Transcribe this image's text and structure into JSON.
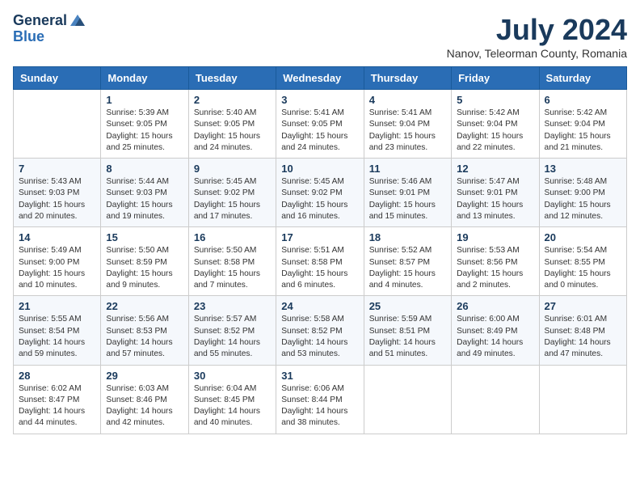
{
  "logo": {
    "line1": "General",
    "line2": "Blue"
  },
  "title": "July 2024",
  "subtitle": "Nanov, Teleorman County, Romania",
  "days_of_week": [
    "Sunday",
    "Monday",
    "Tuesday",
    "Wednesday",
    "Thursday",
    "Friday",
    "Saturday"
  ],
  "weeks": [
    [
      {
        "day": "",
        "info": ""
      },
      {
        "day": "1",
        "info": "Sunrise: 5:39 AM\nSunset: 9:05 PM\nDaylight: 15 hours\nand 25 minutes."
      },
      {
        "day": "2",
        "info": "Sunrise: 5:40 AM\nSunset: 9:05 PM\nDaylight: 15 hours\nand 24 minutes."
      },
      {
        "day": "3",
        "info": "Sunrise: 5:41 AM\nSunset: 9:05 PM\nDaylight: 15 hours\nand 24 minutes."
      },
      {
        "day": "4",
        "info": "Sunrise: 5:41 AM\nSunset: 9:04 PM\nDaylight: 15 hours\nand 23 minutes."
      },
      {
        "day": "5",
        "info": "Sunrise: 5:42 AM\nSunset: 9:04 PM\nDaylight: 15 hours\nand 22 minutes."
      },
      {
        "day": "6",
        "info": "Sunrise: 5:42 AM\nSunset: 9:04 PM\nDaylight: 15 hours\nand 21 minutes."
      }
    ],
    [
      {
        "day": "7",
        "info": "Sunrise: 5:43 AM\nSunset: 9:03 PM\nDaylight: 15 hours\nand 20 minutes."
      },
      {
        "day": "8",
        "info": "Sunrise: 5:44 AM\nSunset: 9:03 PM\nDaylight: 15 hours\nand 19 minutes."
      },
      {
        "day": "9",
        "info": "Sunrise: 5:45 AM\nSunset: 9:02 PM\nDaylight: 15 hours\nand 17 minutes."
      },
      {
        "day": "10",
        "info": "Sunrise: 5:45 AM\nSunset: 9:02 PM\nDaylight: 15 hours\nand 16 minutes."
      },
      {
        "day": "11",
        "info": "Sunrise: 5:46 AM\nSunset: 9:01 PM\nDaylight: 15 hours\nand 15 minutes."
      },
      {
        "day": "12",
        "info": "Sunrise: 5:47 AM\nSunset: 9:01 PM\nDaylight: 15 hours\nand 13 minutes."
      },
      {
        "day": "13",
        "info": "Sunrise: 5:48 AM\nSunset: 9:00 PM\nDaylight: 15 hours\nand 12 minutes."
      }
    ],
    [
      {
        "day": "14",
        "info": "Sunrise: 5:49 AM\nSunset: 9:00 PM\nDaylight: 15 hours\nand 10 minutes."
      },
      {
        "day": "15",
        "info": "Sunrise: 5:50 AM\nSunset: 8:59 PM\nDaylight: 15 hours\nand 9 minutes."
      },
      {
        "day": "16",
        "info": "Sunrise: 5:50 AM\nSunset: 8:58 PM\nDaylight: 15 hours\nand 7 minutes."
      },
      {
        "day": "17",
        "info": "Sunrise: 5:51 AM\nSunset: 8:58 PM\nDaylight: 15 hours\nand 6 minutes."
      },
      {
        "day": "18",
        "info": "Sunrise: 5:52 AM\nSunset: 8:57 PM\nDaylight: 15 hours\nand 4 minutes."
      },
      {
        "day": "19",
        "info": "Sunrise: 5:53 AM\nSunset: 8:56 PM\nDaylight: 15 hours\nand 2 minutes."
      },
      {
        "day": "20",
        "info": "Sunrise: 5:54 AM\nSunset: 8:55 PM\nDaylight: 15 hours\nand 0 minutes."
      }
    ],
    [
      {
        "day": "21",
        "info": "Sunrise: 5:55 AM\nSunset: 8:54 PM\nDaylight: 14 hours\nand 59 minutes."
      },
      {
        "day": "22",
        "info": "Sunrise: 5:56 AM\nSunset: 8:53 PM\nDaylight: 14 hours\nand 57 minutes."
      },
      {
        "day": "23",
        "info": "Sunrise: 5:57 AM\nSunset: 8:52 PM\nDaylight: 14 hours\nand 55 minutes."
      },
      {
        "day": "24",
        "info": "Sunrise: 5:58 AM\nSunset: 8:52 PM\nDaylight: 14 hours\nand 53 minutes."
      },
      {
        "day": "25",
        "info": "Sunrise: 5:59 AM\nSunset: 8:51 PM\nDaylight: 14 hours\nand 51 minutes."
      },
      {
        "day": "26",
        "info": "Sunrise: 6:00 AM\nSunset: 8:49 PM\nDaylight: 14 hours\nand 49 minutes."
      },
      {
        "day": "27",
        "info": "Sunrise: 6:01 AM\nSunset: 8:48 PM\nDaylight: 14 hours\nand 47 minutes."
      }
    ],
    [
      {
        "day": "28",
        "info": "Sunrise: 6:02 AM\nSunset: 8:47 PM\nDaylight: 14 hours\nand 44 minutes."
      },
      {
        "day": "29",
        "info": "Sunrise: 6:03 AM\nSunset: 8:46 PM\nDaylight: 14 hours\nand 42 minutes."
      },
      {
        "day": "30",
        "info": "Sunrise: 6:04 AM\nSunset: 8:45 PM\nDaylight: 14 hours\nand 40 minutes."
      },
      {
        "day": "31",
        "info": "Sunrise: 6:06 AM\nSunset: 8:44 PM\nDaylight: 14 hours\nand 38 minutes."
      },
      {
        "day": "",
        "info": ""
      },
      {
        "day": "",
        "info": ""
      },
      {
        "day": "",
        "info": ""
      }
    ]
  ]
}
